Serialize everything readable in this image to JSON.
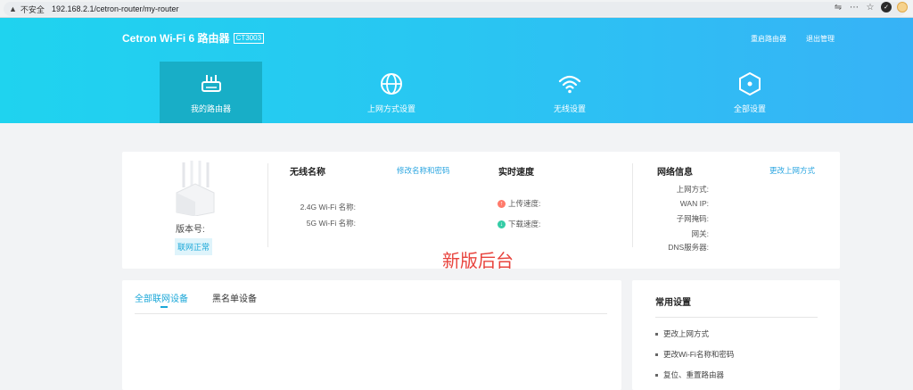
{
  "browser": {
    "insecure_label": "不安全",
    "url": "192.168.2.1/cetron-router/my-router",
    "icons": [
      "translate-icon",
      "more-icon",
      "star-icon",
      "extension-icon",
      "profile-avatar"
    ]
  },
  "header": {
    "brand": "Cetron Wi-Fi 6 路由器",
    "model": "CT3003",
    "reboot_label": "重启路由器",
    "logout_label": "退出管理"
  },
  "nav": {
    "items": [
      {
        "label": "我的路由器",
        "icon": "router-icon",
        "active": true
      },
      {
        "label": "上网方式设置",
        "icon": "globe-icon",
        "active": false
      },
      {
        "label": "无线设置",
        "icon": "wifi-icon",
        "active": false
      },
      {
        "label": "全部设置",
        "icon": "hexagon-settings-icon",
        "active": false
      }
    ]
  },
  "router": {
    "version_label": "版本号:",
    "status": "联网正常"
  },
  "wireless": {
    "title": "无线名称",
    "link": "修改名称和密码",
    "label_24g": "2.4G Wi-Fi 名称:",
    "label_5g": "5G Wi-Fi 名称:"
  },
  "speed": {
    "title": "实时速度",
    "upload_label": "上传速度:",
    "download_label": "下载速度:"
  },
  "network": {
    "title": "网络信息",
    "link": "更改上网方式",
    "labels": [
      "上网方式:",
      "WAN IP:",
      "子网掩码:",
      "网关:",
      "DNS服务器:"
    ]
  },
  "overlay": {
    "text": "新版后台"
  },
  "devices": {
    "tab_all": "全部联网设备",
    "tab_blacklist": "黑名单设备"
  },
  "settings": {
    "title": "常用设置",
    "items": [
      "更改上网方式",
      "更改Wi-Fi名称和密码",
      "复位、重置路由器"
    ]
  },
  "colors": {
    "header_start": "#1fd3ef",
    "header_end": "#37b2f6",
    "active_nav": "#18aec7",
    "accent": "#1aa7d8",
    "overlay_red": "#e8443e"
  }
}
